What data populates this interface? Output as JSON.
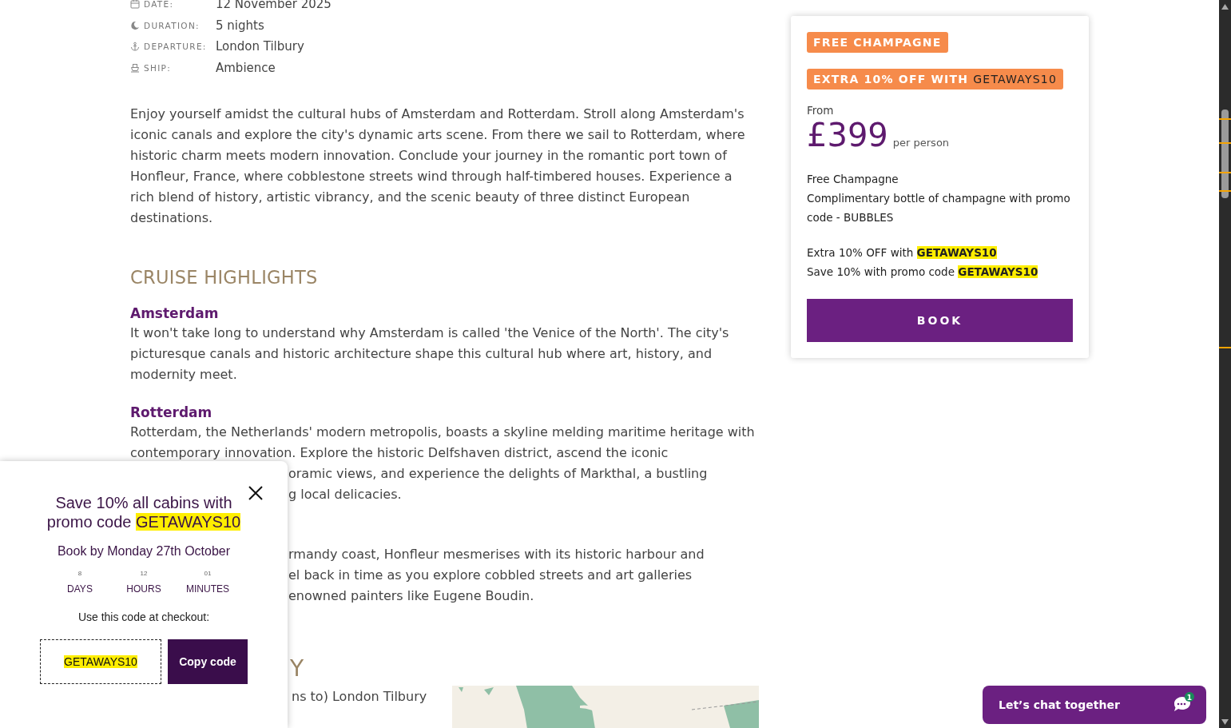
{
  "trip_details": [
    {
      "kind": "calendar",
      "label": "DATE:",
      "value": "12 November 2025"
    },
    {
      "kind": "moon",
      "label": "DURATION:",
      "value": "5 nights"
    },
    {
      "kind": "anchor",
      "label": "DEPARTURE:",
      "value": "London Tilbury"
    },
    {
      "kind": "ship",
      "label": "SHIP:",
      "value": "Ambience"
    }
  ],
  "intro": "Enjoy yourself amidst the cultural hubs of Amsterdam and Rotterdam. Stroll along Amsterdam's iconic canals and explore the city's dynamic arts scene. From there we sail to Rotterdam, where historic charm meets modern innovation. Conclude your journey in the romantic port town of Honfleur, France, where cobblestone streets wind through half-timbered houses. Experience a rich blend of history, artistic vibrancy, and the scenic beauty of three distinct European destinations.",
  "highlights": {
    "title": "CRUISE HIGHLIGHTS",
    "items": [
      {
        "name": "Amsterdam",
        "text": "It won't take long to understand why Amsterdam is called 'the Venice of the North'. The city's picturesque canals and historic architecture shape this cultural hub where art, history, and modernity meet."
      },
      {
        "name": "Rotterdam",
        "text": "Rotterdam, the Netherlands' modern metropolis, boasts a skyline melding maritime heritage with contemporary innovation. Explore the historic Delfshaven district, ascend the iconic"
      }
    ],
    "partly_covered": [
      {
        "kind": "line",
        "text": "oramic views, and experience the delights of Markthal, a bustling"
      },
      {
        "kind": "line",
        "text": "g local delicacies."
      },
      {
        "kind": "gap"
      },
      {
        "kind": "line",
        "text": "rmandy coast, Honfleur mesmerises with its historic harbour and"
      },
      {
        "kind": "line",
        "text": "el back in time as you explore cobbled streets and art galleries"
      },
      {
        "kind": "line",
        "text": "enowned painters like Eugene Boudin."
      }
    ]
  },
  "itinerary": {
    "title": "Y",
    "first_stop": "ns to) London Tilbury"
  },
  "booking_card": {
    "badges": [
      {
        "text": "FREE CHAMPAGNE"
      },
      {
        "text": "EXTRA 10% OFF WITH ",
        "code": "GETAWAYS10"
      }
    ],
    "from_label": "From",
    "price": "£399",
    "price_unit": "per person",
    "offers": [
      {
        "title": "Free Champagne",
        "lines": [
          {
            "text": "Complimentary bottle of champagne with promo code - BUBBLES"
          }
        ]
      },
      {
        "title": "Extra 10% OFF with ",
        "title_code": "GETAWAYS10",
        "lines": [
          {
            "text": "Save 10% with promo code ",
            "code": "GETAWAYS10"
          }
        ]
      }
    ],
    "book_button": "BOOK"
  },
  "promo_popup": {
    "headline": "Save 10% all cabins with promo code ",
    "headline_code": "GETAWAYS10",
    "deadline": "Book by Monday 27th October",
    "countdown": [
      {
        "value": "8",
        "unit": "DAYS"
      },
      {
        "value": "12",
        "unit": "HOURS"
      },
      {
        "value": "01",
        "unit": "MINUTES"
      }
    ],
    "instruction": "Use this code at checkout:",
    "code": "GETAWAYS10",
    "copy_button": "Copy code"
  },
  "chat_button": {
    "label": "Let’s chat together",
    "unread": "1"
  }
}
